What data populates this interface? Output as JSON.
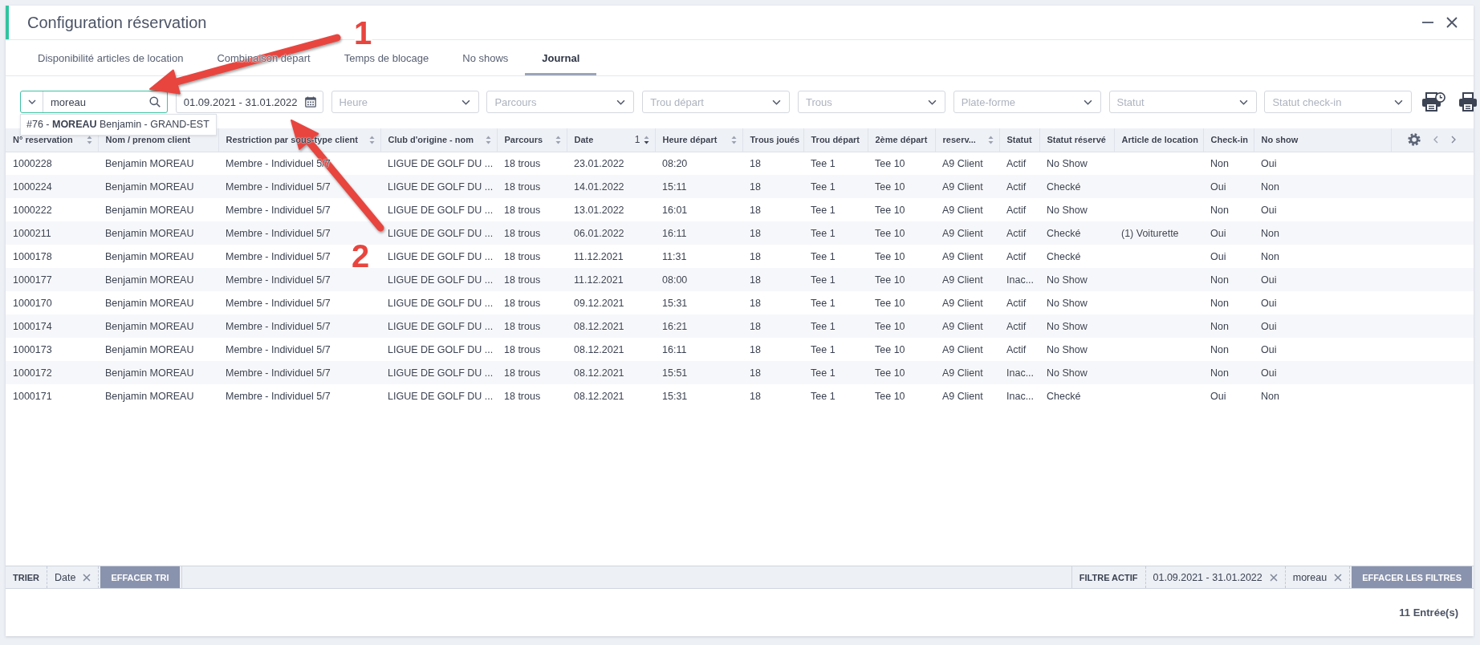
{
  "window": {
    "title": "Configuration réservation"
  },
  "tabs": [
    {
      "label": "Disponibilité articles de location",
      "selected": false
    },
    {
      "label": "Combinaison départ",
      "selected": false
    },
    {
      "label": "Temps de blocage",
      "selected": false
    },
    {
      "label": "No shows",
      "selected": false
    },
    {
      "label": "Journal",
      "selected": true
    }
  ],
  "filters": {
    "search": {
      "value": "moreau",
      "focused": true,
      "suggestions": [
        "#76 - **MOREAU** Benjamin - GRAND-EST"
      ]
    },
    "date_range": {
      "value": "01.09.2021 - 31.01.2022"
    },
    "selects": [
      {
        "placeholder": "Heure"
      },
      {
        "placeholder": "Parcours"
      },
      {
        "placeholder": "Trou départ"
      },
      {
        "placeholder": "Trous"
      },
      {
        "placeholder": "Plate-forme"
      },
      {
        "placeholder": "Statut"
      },
      {
        "placeholder": "Statut check-in"
      }
    ]
  },
  "table": {
    "columns": [
      {
        "label": "N° reservation",
        "sortable": true,
        "sorted": false
      },
      {
        "label": "Nom / prenom client",
        "sortable": false
      },
      {
        "label": "Restriction par sous-type client",
        "sortable": true,
        "sorted": false
      },
      {
        "label": "Club d'origine - nom",
        "sortable": true,
        "sorted": false
      },
      {
        "label": "Parcours",
        "sortable": true,
        "sorted": false
      },
      {
        "label": "Date",
        "sortable": true,
        "sorted": true,
        "sort_rank": "1"
      },
      {
        "label": "Heure départ",
        "sortable": true,
        "sorted": false
      },
      {
        "label": "Trous joués",
        "sortable": false
      },
      {
        "label": "Trou départ",
        "sortable": false
      },
      {
        "label": "2ème départ",
        "sortable": false
      },
      {
        "label": "reserv...",
        "sortable": true,
        "sorted": false
      },
      {
        "label": "Statut",
        "sortable": false
      },
      {
        "label": "Statut réservé",
        "sortable": false
      },
      {
        "label": "Article de location",
        "sortable": false
      },
      {
        "label": "Check-in",
        "sortable": false
      },
      {
        "label": "No show",
        "sortable": false
      }
    ],
    "rows": [
      {
        "cells": [
          "1000228",
          "Benjamin MOREAU",
          "Membre - Individuel 5/7",
          "LIGUE DE GOLF DU ...",
          "18 trous",
          "23.01.2022",
          "08:20",
          "18",
          "Tee 1",
          "Tee 10",
          "A9 Client",
          "Actif",
          "No Show",
          null,
          "Non",
          "Oui"
        ]
      },
      {
        "cells": [
          "1000224",
          "Benjamin MOREAU",
          "Membre - Individuel 5/7",
          "LIGUE DE GOLF DU ...",
          "18 trous",
          "14.01.2022",
          "15:11",
          "18",
          "Tee 1",
          "Tee 10",
          "A9 Client",
          "Actif",
          "Checké",
          null,
          "Oui",
          "Non"
        ]
      },
      {
        "cells": [
          "1000222",
          "Benjamin MOREAU",
          "Membre - Individuel 5/7",
          "LIGUE DE GOLF DU ...",
          "18 trous",
          "13.01.2022",
          "16:01",
          "18",
          "Tee 1",
          "Tee 10",
          "A9 Client",
          "Actif",
          "No Show",
          null,
          "Non",
          "Oui"
        ]
      },
      {
        "cells": [
          "1000211",
          "Benjamin MOREAU",
          "Membre - Individuel 5/7",
          "LIGUE DE GOLF DU ...",
          "18 trous",
          "06.01.2022",
          "16:11",
          "18",
          "Tee 1",
          "Tee 10",
          "A9 Client",
          "Actif",
          "Checké",
          "(1) Voiturette",
          "Oui",
          "Non"
        ]
      },
      {
        "cells": [
          "1000178",
          "Benjamin MOREAU",
          "Membre - Individuel 5/7",
          "LIGUE DE GOLF DU ...",
          "18 trous",
          "11.12.2021",
          "11:31",
          "18",
          "Tee 1",
          "Tee 10",
          "A9 Client",
          "Actif",
          "Checké",
          null,
          "Oui",
          "Non"
        ]
      },
      {
        "cells": [
          "1000177",
          "Benjamin MOREAU",
          "Membre - Individuel 5/7",
          "LIGUE DE GOLF DU ...",
          "18 trous",
          "11.12.2021",
          "08:00",
          "18",
          "Tee 1",
          "Tee 10",
          "A9 Client",
          "Inac...",
          "No Show",
          null,
          "Non",
          "Oui"
        ]
      },
      {
        "cells": [
          "1000170",
          "Benjamin MOREAU",
          "Membre - Individuel 5/7",
          "LIGUE DE GOLF DU ...",
          "18 trous",
          "09.12.2021",
          "15:31",
          "18",
          "Tee 1",
          "Tee 10",
          "A9 Client",
          "Actif",
          "No Show",
          null,
          "Non",
          "Oui"
        ]
      },
      {
        "cells": [
          "1000174",
          "Benjamin MOREAU",
          "Membre - Individuel 5/7",
          "LIGUE DE GOLF DU ...",
          "18 trous",
          "08.12.2021",
          "16:21",
          "18",
          "Tee 1",
          "Tee 10",
          "A9 Client",
          "Actif",
          "No Show",
          null,
          "Non",
          "Oui"
        ]
      },
      {
        "cells": [
          "1000173",
          "Benjamin MOREAU",
          "Membre - Individuel 5/7",
          "LIGUE DE GOLF DU ...",
          "18 trous",
          "08.12.2021",
          "16:11",
          "18",
          "Tee 1",
          "Tee 10",
          "A9 Client",
          "Actif",
          "No Show",
          null,
          "Non",
          "Oui"
        ]
      },
      {
        "cells": [
          "1000172",
          "Benjamin MOREAU",
          "Membre - Individuel 5/7",
          "LIGUE DE GOLF DU ...",
          "18 trous",
          "08.12.2021",
          "15:51",
          "18",
          "Tee 1",
          "Tee 10",
          "A9 Client",
          "Inac...",
          "No Show",
          null,
          "Non",
          "Oui"
        ]
      },
      {
        "cells": [
          "1000171",
          "Benjamin MOREAU",
          "Membre - Individuel 5/7",
          "LIGUE DE GOLF DU ...",
          "18 trous",
          "08.12.2021",
          "15:31",
          "18",
          "Tee 1",
          "Tee 10",
          "A9 Client",
          "Inac...",
          "Checké",
          null,
          "Oui",
          "Non"
        ]
      }
    ]
  },
  "sort_bar": {
    "label": "TRIER",
    "items": [
      "Date"
    ],
    "clear_button": "EFFACER TRI"
  },
  "filter_bar": {
    "label": "FILTRE ACTIF",
    "items": [
      "01.09.2021 - 31.01.2022",
      "moreau"
    ],
    "clear_button": "EFFACER LES FILTRES"
  },
  "status_bar": {
    "count": "11 Entrée(s)"
  },
  "annotations": [
    {
      "kind": "arrow",
      "label": "1"
    },
    {
      "kind": "arrow",
      "label": "2"
    }
  ]
}
